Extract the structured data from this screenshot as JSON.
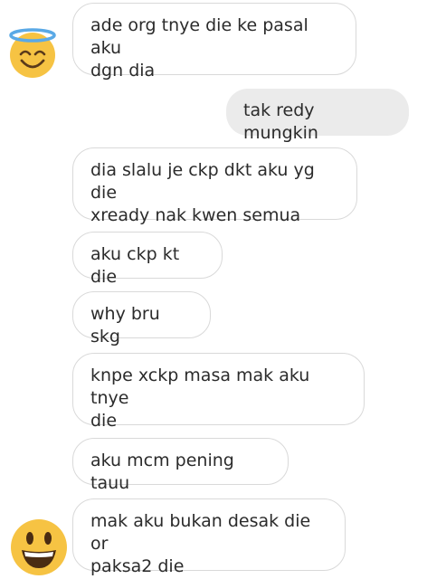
{
  "conversation": {
    "messages": [
      {
        "sender": "them",
        "text": "ade org tnye die ke pasal aku\ndgn dia"
      },
      {
        "sender": "me",
        "text": "tak redy mungkin"
      },
      {
        "sender": "them",
        "text": "dia slalu je ckp dkt aku yg die\nxready nak kwen semua"
      },
      {
        "sender": "them",
        "text": "aku ckp kt die"
      },
      {
        "sender": "them",
        "text": "why bru skg"
      },
      {
        "sender": "them",
        "text": "knpe xckp masa mak aku tnye\ndie"
      },
      {
        "sender": "them",
        "text": "aku mcm pening tauu"
      },
      {
        "sender": "them",
        "text": "mak aku bukan desak die or\npaksa2 die"
      }
    ],
    "avatars": [
      {
        "icon": "smiling-face-with-halo-icon"
      },
      {
        "icon": "grinning-face-icon"
      }
    ],
    "colors": {
      "incoming_border": "#d9d9d9",
      "outgoing_background": "#ebebeb",
      "emoji_yellow": "#f6c343"
    }
  }
}
